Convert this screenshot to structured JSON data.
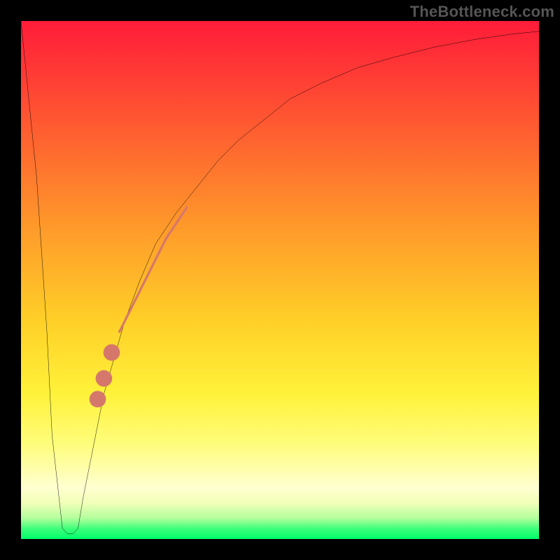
{
  "watermark": "TheBottleneck.com",
  "chart_data": {
    "type": "line",
    "title": "",
    "xlabel": "",
    "ylabel": "",
    "xlim": [
      0,
      100
    ],
    "ylim": [
      0,
      100
    ],
    "grid": false,
    "legend": false,
    "series": [
      {
        "name": "bottleneck-curve",
        "color": "#000000",
        "x": [
          0,
          3,
          5,
          6,
          8,
          9,
          10,
          11,
          12,
          14,
          16,
          18,
          20,
          23,
          26,
          30,
          34,
          38,
          42,
          47,
          52,
          58,
          65,
          72,
          80,
          88,
          95,
          100
        ],
        "values": [
          100,
          70,
          40,
          20,
          2,
          1,
          1,
          2,
          8,
          18,
          28,
          35,
          42,
          50,
          57,
          63,
          68,
          73,
          77,
          81,
          85,
          88,
          91,
          93,
          95,
          96.5,
          97.5,
          98
        ]
      }
    ],
    "annotations": [
      {
        "name": "highlight-segment",
        "type": "thick-line",
        "color": "#d5786b",
        "width": 3.2,
        "x": [
          19,
          20,
          22,
          24,
          26,
          28,
          30,
          32
        ],
        "values": [
          40,
          42,
          46,
          50,
          54,
          58,
          61,
          64
        ]
      },
      {
        "name": "highlight-dots",
        "type": "scatter",
        "color": "#d5786b",
        "radius": 1.6,
        "points": [
          {
            "x": 17.5,
            "y": 36
          },
          {
            "x": 16.0,
            "y": 31
          },
          {
            "x": 14.8,
            "y": 27
          }
        ]
      }
    ],
    "background_gradient": {
      "direction": "vertical",
      "stops": [
        {
          "pos": 0,
          "color": "#ff1c39"
        },
        {
          "pos": 40,
          "color": "#ff9a2a"
        },
        {
          "pos": 72,
          "color": "#fff23a"
        },
        {
          "pos": 92,
          "color": "#ffffd0"
        },
        {
          "pos": 100,
          "color": "#00ff6a"
        }
      ]
    }
  }
}
